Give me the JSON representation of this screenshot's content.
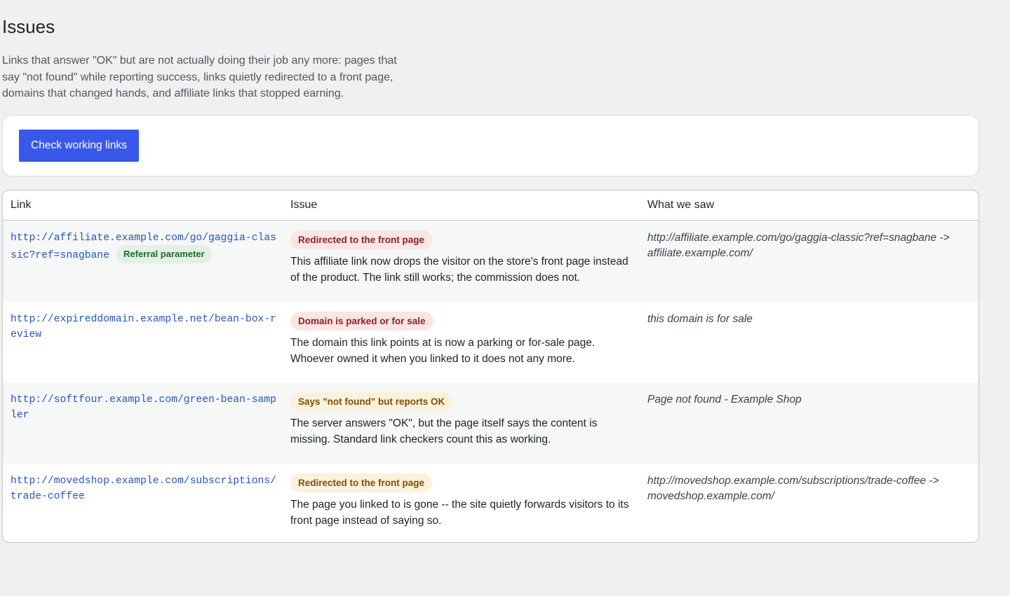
{
  "header": {
    "title": "Issues",
    "description": "Links that answer \"OK\" but are not actually doing their job any more: pages that say \"not found\" while reporting success, links quietly redirected to a front page, domains that changed hands, and affiliate links that stopped earning."
  },
  "actions": {
    "check_button_label": "Check working links"
  },
  "table": {
    "columns": {
      "link": "Link",
      "issue": "Issue",
      "saw": "What we saw"
    },
    "rows": [
      {
        "url": "http://affiliate.example.com/go/gaggia-classic?ref=snagbane",
        "tag": "Referral parameter",
        "issue_label": "Redirected to the front page",
        "issue_color": "#fbe5e5",
        "issue_text": "This affiliate link now drops the visitor on the store's front page instead of the product. The link still works; the commission does not.",
        "saw": "http://affiliate.example.com/go/gaggia-classic?ref=snagbane -> affiliate.example.com/"
      },
      {
        "url": "http://expireddomain.example.net/bean-box-review",
        "tag": "",
        "issue_label": "Domain is parked or for sale",
        "issue_color": "#fbe5e5",
        "issue_text": "The domain this link points at is now a parking or for-sale page. Whoever owned it when you linked to it does not any more.",
        "saw": "this domain is for sale"
      },
      {
        "url": "http://softfour.example.com/green-bean-sampler",
        "tag": "",
        "issue_label": "Says \"not found\" but reports OK",
        "issue_color": "#fcf1dc",
        "issue_text": "The server answers \"OK\", but the page itself says the content is missing. Standard link checkers count this as working.",
        "saw": "Page not found - Example Shop"
      },
      {
        "url": "http://movedshop.example.com/subscriptions/trade-coffee",
        "tag": "",
        "issue_label": "Redirected to the front page",
        "issue_color": "#fcf1dc",
        "issue_text": "The page you linked to is gone -- the site quietly forwards visitors to its front page instead of saying so.",
        "saw": "http://movedshop.example.com/subscriptions/trade-coffee -> movedshop.example.com/"
      }
    ]
  },
  "colors": {
    "accent": "#3858e9",
    "link": "#2a55b9",
    "background": "#f0f0f1"
  }
}
